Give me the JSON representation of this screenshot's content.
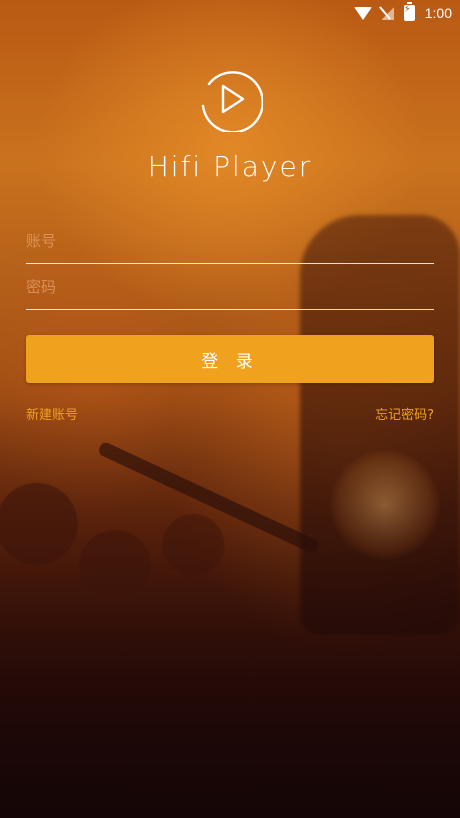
{
  "status_bar": {
    "time": "1:00",
    "icons": [
      "wifi-icon",
      "signal-icon",
      "battery-icon"
    ]
  },
  "app": {
    "title": "Hifi Player",
    "logo_icon": "play-circle-icon"
  },
  "form": {
    "account_placeholder": "账号",
    "password_placeholder": "密码",
    "login_label": "登 录",
    "register_label": "新建账号",
    "forgot_label": "忘记密码?"
  },
  "colors": {
    "accent": "#f0a21f",
    "text": "#ffffff"
  }
}
